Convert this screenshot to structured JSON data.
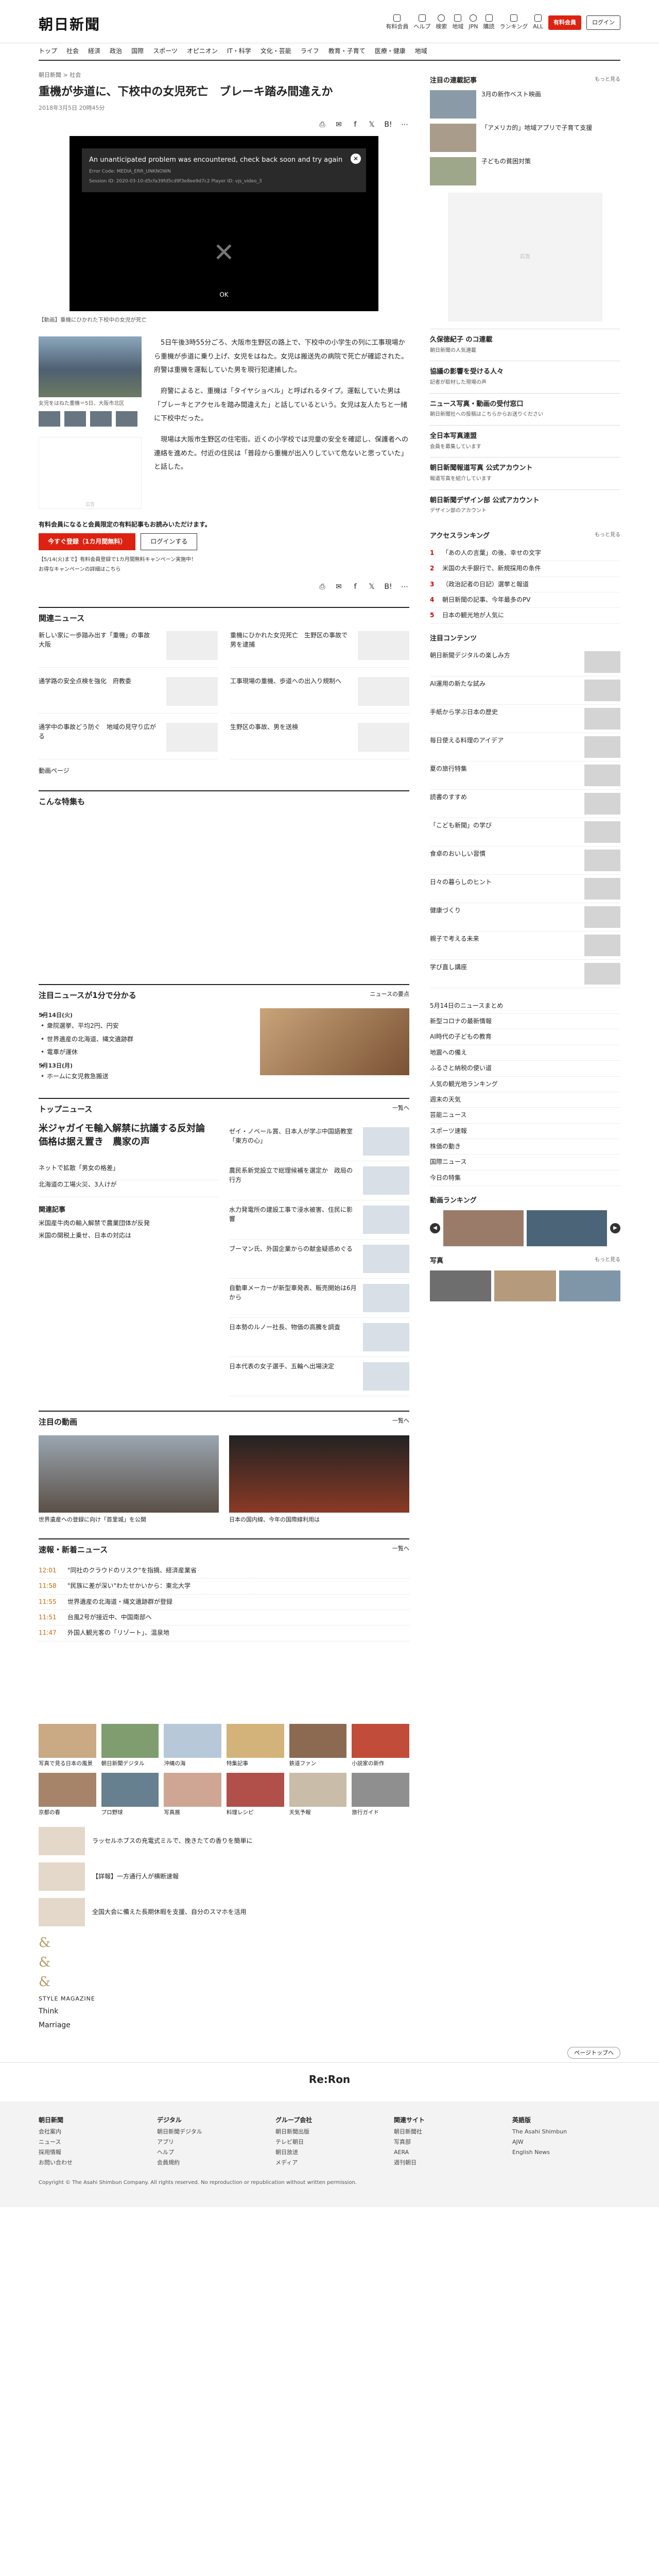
{
  "header": {
    "logo": "朝日新聞",
    "util": [
      "有料会員",
      "ヘルプ",
      "検索",
      "地域",
      "JPN",
      "購読",
      "ランキング",
      "ALL"
    ],
    "subscribe": "有料会員",
    "login": "ログイン"
  },
  "gnav": [
    "トップ",
    "社会",
    "経済",
    "政治",
    "国際",
    "スポーツ",
    "オピニオン",
    "IT・科学",
    "文化・芸能",
    "ライフ",
    "教育・子育て",
    "医療・健康",
    "地域"
  ],
  "breadcrumb": "朝日新聞 > 社会",
  "article": {
    "title": "重機が歩道に、下校中の女児死亡　ブレーキ踏み間違えか",
    "date": "2018年3月5日 20時45分",
    "video_error": "An unanticipated problem was encountered, check back soon and try again",
    "video_code": "Error Code: MEDIA_ERR_UNKNOWN",
    "video_session": "Session ID: 2020-03-10:d5cfa39fd5cd9f3e8ee9d7c2 Player ID: vjs_video_3",
    "video_ok": "OK",
    "video_caption": "【動画】重機にひかれた下校中の女児が死亡",
    "photo_caption": "女児をはねた重機＝5日、大阪市北区",
    "paragraphs": [
      "5日午後3時55分ごろ、大阪市生野区の路上で、下校中の小学生の列に工事現場から重機が歩道に乗り上げ、女児をはねた。女児は搬送先の病院で死亡が確認された。府警は重機を運転していた男を現行犯逮捕した。",
      "府警によると、重機は「タイヤショベル」と呼ばれるタイプ。運転していた男は「ブレーキとアクセルを踏み間違えた」と話しているという。女児は友人たちと一緒に下校中だった。",
      "現場は大阪市生野区の住宅街。近くの小学校では児童の安全を確認し、保護者への連絡を進めた。付近の住民は「普段から重機が出入りしていて危ないと思っていた」と話した。"
    ],
    "ad_label": "広告"
  },
  "paywall": {
    "lead": "有料会員になると会員限定の有料記事もお読みいただけます。",
    "subscribe": "今すぐ登録（1カ月間無料）",
    "login": "ログインする",
    "note1": "【5/14(火)まで】有料会員登録で1カ月間無料キャンペーン実施中！",
    "note2": "お得なキャンペーンの詳細はこちら"
  },
  "related": {
    "title": "関連ニュース",
    "items": [
      "新しい家に一歩踏み出す「重機」の事故　大阪",
      "重機にひかれた女児死亡　生野区の事故で男を逮捕",
      "通学路の安全点検を強化　府教委",
      "工事現場の重機、歩道への出入り規制へ",
      "通学中の事故どう防ぐ　地域の見守り広がる",
      "生野区の事故、男を送検"
    ],
    "video_page": "動画ページ"
  },
  "special": "こんな特集も",
  "daily": {
    "title": "注目ニュースが1分で分かる",
    "more": "ニュースの要点",
    "date1": "5月14日(火)",
    "items1": [
      "衆院選挙、平均2円、円安",
      "世界遺産の北海道、縄文遺跡群",
      "電車が運休"
    ],
    "date2": "5月13日(月)",
    "items2": [
      "ホームに女児救急搬送"
    ]
  },
  "topnews": {
    "title": "トップニュース",
    "more": "一覧へ",
    "lead": "米ジャガイモ輸入解禁に抗議する反対論　価格は据え置き　農家の声",
    "side_items": [
      "ネットで拡散「男女の格差」",
      "北海道の工場火災、3人けが",
      "国際会議で首脳会談へ",
      "全国の天気、週末は雨"
    ],
    "items": [
      "ゼイ・ノベール賞、日本人が学ぶ中国語教室「東方の心」",
      "農民系新党設立で総理候補を選定か　政局の行方",
      "水力発電所の建設工事で浸水被害、住民に影響",
      "ブーマン氏、外国企業からの献金疑惑めぐる",
      "自動車メーカーが新型車発表、販売開始は6月から",
      "日本勢のルノー社長、物価の高騰を調査",
      "日本代表の女子選手、五輪へ出場決定"
    ]
  },
  "related2": {
    "title": "関連記事",
    "items": [
      "米国産牛肉の輸入解禁で農業団体が反発",
      "米国の関税上乗せ、日本の対応は"
    ]
  },
  "movies": {
    "title": "注目の動画",
    "more": "一覧へ",
    "items": [
      "世界遺産への登録に向け「首里城」を公開",
      "日本の国内線、今年の国際線利用は"
    ]
  },
  "info": {
    "title": "速報・新着ニュース",
    "more": "一覧へ",
    "rows": [
      {
        "t": "12:01",
        "text": "\"同社のクラウドのリスク\"を指摘、経済産業省"
      },
      {
        "t": "11:58",
        "text": "\"民族に差が深い\"わたせかいから：東北大学"
      },
      {
        "t": "11:55",
        "text": "世界遺産の北海道・縄文遺跡群が登録"
      },
      {
        "t": "11:51",
        "text": "台風2号が接近中、中国南部へ"
      },
      {
        "t": "11:47",
        "text": "外国人観光客の「リゾート」、温泉地"
      }
    ]
  },
  "tiles": [
    "写真で見る日本の風景",
    "朝日新聞デジタル",
    "沖縄の海",
    "特集記事",
    "鉄道ファン",
    "小説家の新作",
    "京都の春",
    "プロ野球",
    "写真展",
    "料理レシピ",
    "天気予報",
    "旅行ガイド"
  ],
  "promos": [
    "ラッセルホブスの充電式ミルで、挽きたての香りを簡単に",
    "【詳報】一方通行人が横断速報",
    "全国大会に備えた長期休暇を支援、自分のスマホを活用"
  ],
  "brands": [
    "&",
    "&",
    "&",
    "STYLE MAGAZINE",
    "Think",
    "Marriage"
  ],
  "side": {
    "ranking_title": "注目の連載記事",
    "ranking_more": "もっと見る",
    "ranking": [
      "3月の新作ベスト映画",
      "「アメリカ的」地域アプリで子育て支援",
      "子どもの貧困対策"
    ],
    "boxes": [
      {
        "title": "久保徳紀子 のコ連載",
        "sub": "朝日新聞の人気連載"
      },
      {
        "title": "協議の影響を受ける人々",
        "sub": "記者が取材した現場の声"
      },
      {
        "title": "ニュース写真・動画の受付窓口",
        "sub": "朝日新聞社への投稿はこちらからお送りください"
      },
      {
        "title": "全日本写真連盟",
        "sub": "会員を募集しています"
      },
      {
        "title": "朝日新聞報道写真 公式アカウント",
        "sub": "報道写真を紹介しています"
      },
      {
        "title": "朝日新聞デザイン部 公式アカウント",
        "sub": "デザイン部のアカウント"
      }
    ],
    "access_title": "アクセスランキング",
    "access_more": "もっと見る",
    "access": [
      "「あの人の言葉」の後、幸せの文字",
      "米国の大手銀行で、新規採用の条件",
      "（政治記者の日記）選挙と報道",
      "朝日新聞の記事、今年最多のPV",
      "日本の観光地が人気に"
    ],
    "contents_title": "注目コンテンツ",
    "contents": [
      "朝日新聞デジタルの楽しみ方",
      "AI運用の新たな試み",
      "手紙から学ぶ日本の歴史",
      "毎日使える料理のアイデア",
      "夏の旅行特集",
      "読書のすすめ",
      "「こども新聞」の学び",
      "食卓のおいしい習慣",
      "日々の暮らしのヒント",
      "健康づくり",
      "親子で考える未来",
      "学び直し講座"
    ],
    "news_links": [
      "5月14日のニュースまとめ",
      "新型コロナの最新情報",
      "AI時代の子どもの教育",
      "地震への備え",
      "ふるさと納税の使い道",
      "人気の観光地ランキング",
      "週末の天気",
      "芸能ニュース",
      "スポーツ速報",
      "株価の動き",
      "国際ニュース",
      "今日の特集"
    ],
    "photo_rank_title": "動画ランキング",
    "photo_title": "写真",
    "photo_more": "もっと見る"
  },
  "footer": {
    "back_top": "ページトップへ",
    "brand": "Re:Ron",
    "cols": [
      {
        "h": "朝日新聞",
        "items": [
          "会社案内",
          "ニュース",
          "採用情報",
          "お問い合わせ"
        ]
      },
      {
        "h": "デジタル",
        "items": [
          "朝日新聞デジタル",
          "アプリ",
          "ヘルプ",
          "会員規約"
        ]
      },
      {
        "h": "グループ会社",
        "items": [
          "朝日新聞出版",
          "テレビ朝日",
          "朝日放送",
          "メディア"
        ]
      },
      {
        "h": "関連サイト",
        "items": [
          "朝日新聞社",
          "写真部",
          "AERA",
          "週刊朝日"
        ]
      },
      {
        "h": "英語版",
        "items": [
          "The Asahi Shimbun",
          "AJW",
          "English News"
        ]
      }
    ],
    "copyright": "Copyright © The Asahi Shimbun Company. All rights reserved. No reproduction or republication without written permission."
  }
}
